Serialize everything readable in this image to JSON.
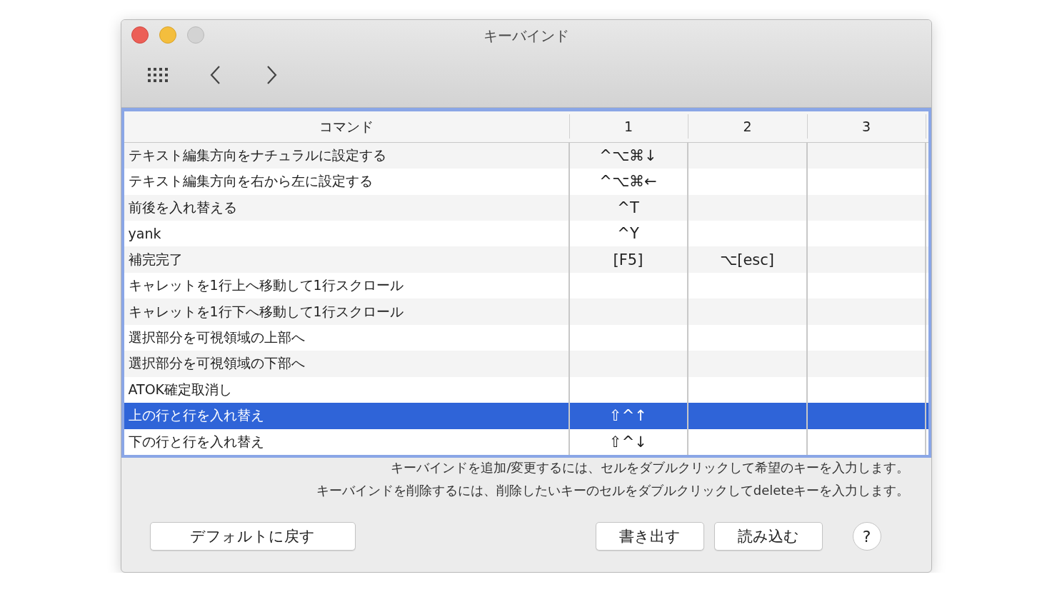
{
  "window": {
    "title": "キーバインド"
  },
  "toolbar": {
    "buttons": [
      {
        "kind": "grid"
      },
      {
        "kind": "back"
      },
      {
        "kind": "forward"
      }
    ]
  },
  "table": {
    "columns": [
      "コマンド",
      "1",
      "2",
      "3"
    ],
    "rows": [
      {
        "command": "テキスト編集方向をナチュラルに設定する",
        "key_1": "^⌥⌘↓",
        "selected": false
      },
      {
        "command": "テキスト編集方向を右から左に設定する",
        "key_1": "^⌥⌘←",
        "selected": false
      },
      {
        "command": "前後を入れ替える",
        "key_1": "^T",
        "selected": false
      },
      {
        "command": "yank",
        "key_1": "^Y",
        "selected": false
      },
      {
        "command": "補完完了",
        "key_1": "[F5]",
        "key_2": "⌥[esc]",
        "selected": false
      },
      {
        "command": "キャレットを1行上へ移動して1行スクロール",
        "selected": false
      },
      {
        "command": "キャレットを1行下へ移動して1行スクロール",
        "selected": false
      },
      {
        "command": "選択部分を可視領域の上部へ",
        "selected": false
      },
      {
        "command": "選択部分を可視領域の下部へ",
        "selected": false
      },
      {
        "command": "ATOK確定取消し",
        "selected": false
      },
      {
        "command": "上の行と行を入れ替え",
        "key_1": "⇧^↑",
        "selected": true
      },
      {
        "command": "下の行と行を入れ替え",
        "key_1": "⇧^↓",
        "selected": false
      }
    ]
  },
  "notes": [
    "キーバインドを追加/変更するには、セルをダブルクリックして希望のキーを入力します。",
    "キーバインドを削除するには、削除したいキーのセルをダブルクリックしてdeleteキーを入力します。"
  ],
  "buttons": {
    "reset": "デフォルトに戻す",
    "export": "書き出す",
    "import": "読み込む",
    "help": "?"
  }
}
